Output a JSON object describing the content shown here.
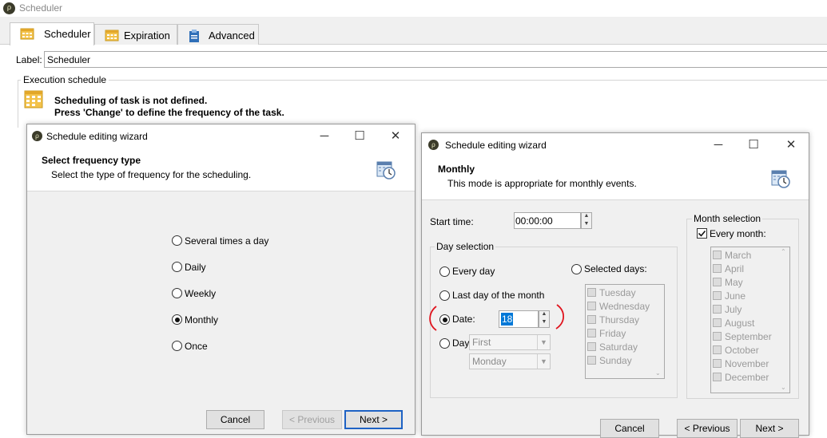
{
  "app": {
    "title": "Scheduler"
  },
  "tabs": [
    {
      "label": "Scheduler",
      "icon": "calendar-icon"
    },
    {
      "label": "Expiration",
      "icon": "calendar-icon"
    },
    {
      "label": "Advanced",
      "icon": "clipboard-icon"
    }
  ],
  "label_row": {
    "label": "Label:",
    "value": "Scheduler"
  },
  "execution": {
    "group_label": "Execution schedule",
    "line1": "Scheduling of task is not defined.",
    "line2": "Press 'Change' to define the frequency of the task."
  },
  "wizard1": {
    "title": "Schedule editing wizard",
    "heading": "Select frequency type",
    "subheading": "Select the type of frequency for the scheduling.",
    "options": [
      "Several times a day",
      "Daily",
      "Weekly",
      "Monthly",
      "Once"
    ],
    "selected": "Monthly",
    "cancel": "Cancel",
    "previous": "< Previous",
    "next": "Next >"
  },
  "wizard2": {
    "title": "Schedule editing wizard",
    "heading": "Monthly",
    "subheading": "This mode is appropriate for monthly events.",
    "start_time_label": "Start time:",
    "start_time_value": "00:00:00",
    "day_selection_label": "Day selection",
    "every_day": "Every day",
    "selected_days": "Selected days:",
    "last_day": "Last day of the month",
    "date_label": "Date:",
    "date_value": "18",
    "day_label": "Day",
    "day_ordinal": "First",
    "day_weekday": "Monday",
    "weekdays": [
      "Tuesday",
      "Wednesday",
      "Thursday",
      "Friday",
      "Saturday",
      "Sunday"
    ],
    "month_selection_label": "Month selection",
    "every_month_label": "Every month:",
    "every_month_checked": true,
    "months": [
      "March",
      "April",
      "May",
      "June",
      "July",
      "August",
      "September",
      "October",
      "November",
      "December"
    ],
    "cancel": "Cancel",
    "previous": "< Previous",
    "next": "Next >"
  },
  "colors": {
    "accent": "#1e62c4",
    "annotation": "#e0141e"
  }
}
